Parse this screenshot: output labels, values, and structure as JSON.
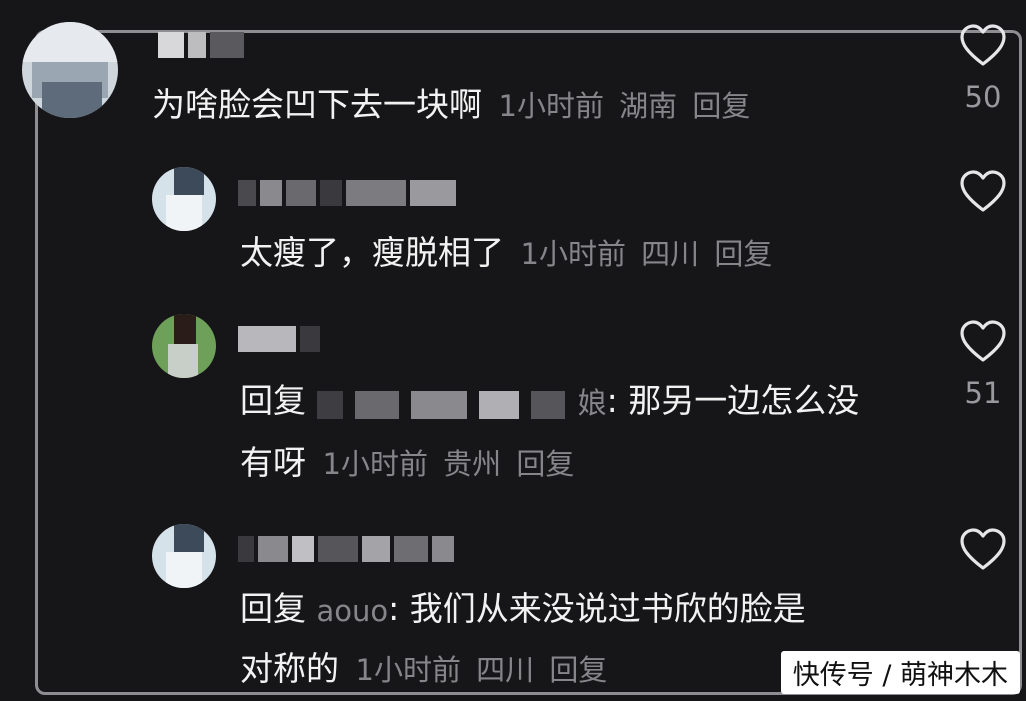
{
  "comments": [
    {
      "text": "为啥脸会凹下去一块啊",
      "time": "1小时前",
      "location": "湖南",
      "reply_label": "回复",
      "likes": "50"
    },
    {
      "text": "太瘦了，瘦脱相了",
      "time": "1小时前",
      "location": "四川",
      "reply_label": "回复",
      "likes": ""
    },
    {
      "prefix": "回复",
      "target_suffix": "娘",
      "text_line1": ": 那另一边怎么没",
      "text_line2": "有呀",
      "time": "1小时前",
      "location": "贵州",
      "reply_label": "回复",
      "likes": "51"
    },
    {
      "prefix": "回复",
      "target": "aouo",
      "text_line1": ": 我们从来没说过书欣的脸是",
      "text_line2": "对称的",
      "time": "1小时前",
      "location": "四川",
      "reply_label": "回复",
      "likes": ""
    }
  ],
  "watermark": "快传号 / 萌神木木",
  "colors": {
    "background": "#161618",
    "text": "#f2f2f2",
    "meta": "#86868a",
    "frame": "#8e8e92"
  }
}
